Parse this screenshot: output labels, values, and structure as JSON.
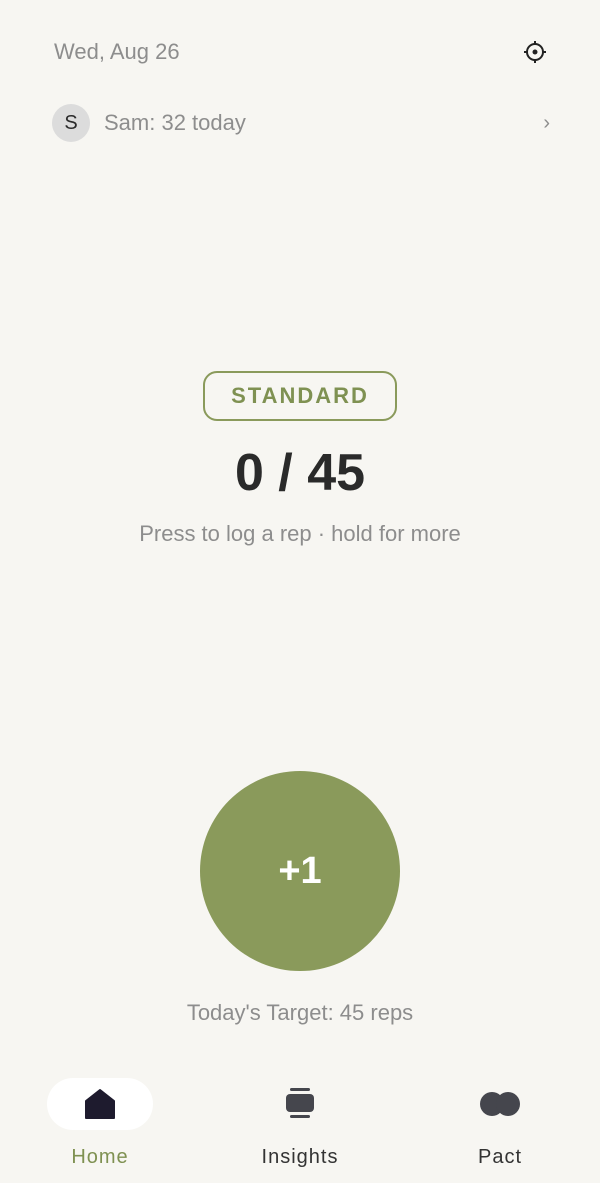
{
  "header": {
    "date": "Wed, Aug 26",
    "settings_icon": "settings-icon"
  },
  "partner": {
    "avatar_initial": "S",
    "status": "Sam: 32 today",
    "chevron": "›"
  },
  "session": {
    "mode": "STANDARD",
    "counter": "0 / 45",
    "hint": "Press to log a rep · hold for more"
  },
  "action": {
    "label": "+1"
  },
  "target": {
    "text": "Today's Target: 45 reps"
  },
  "nav": {
    "items": [
      {
        "label": "Home",
        "icon": "home-icon",
        "active": true
      },
      {
        "label": "Insights",
        "icon": "insights-icon",
        "active": false
      },
      {
        "label": "Pact",
        "icon": "pact-icon",
        "active": false
      }
    ]
  },
  "colors": {
    "accent": "#8a9a5b",
    "background": "#f7f6f2"
  }
}
